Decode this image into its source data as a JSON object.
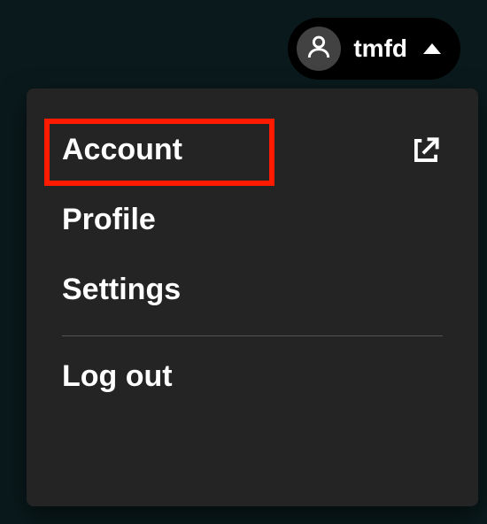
{
  "user_pill": {
    "username": "tmfd"
  },
  "menu": {
    "items": [
      {
        "label": "Account",
        "external": true,
        "highlighted": true
      },
      {
        "label": "Profile",
        "external": false,
        "highlighted": false
      },
      {
        "label": "Settings",
        "external": false,
        "highlighted": false
      }
    ],
    "logout_label": "Log out"
  },
  "highlight_color": "#ff1a00"
}
